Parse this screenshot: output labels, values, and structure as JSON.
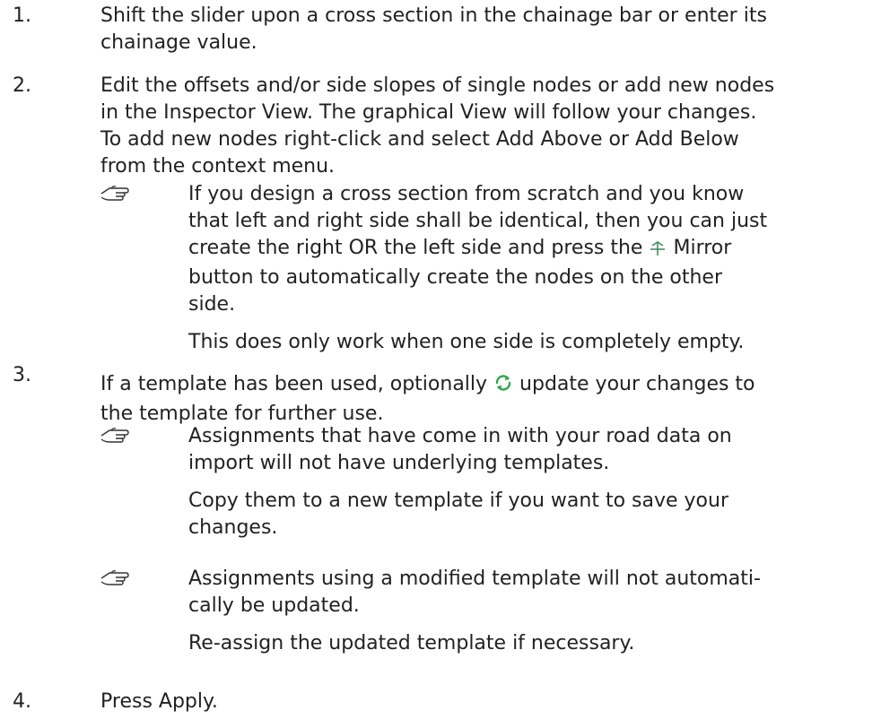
{
  "steps": [
    {
      "number": "1.",
      "lines": [
        "Shift the slider upon a cross section in the chainage bar or enter its",
        "chainage value."
      ]
    },
    {
      "number": "2.",
      "lines": [
        "Edit the offsets and/or side slopes of single nodes or add new nodes",
        "in the Inspector View. The graphical View will follow your changes.",
        "To add new nodes right-click and select Add Above or Add Below",
        "from the context menu."
      ],
      "note": {
        "lines": [
          "If you design a cross section from scratch and you know",
          "that left and right side shall be identical, then you can just"
        ],
        "line3_before": "create the right OR the left side and press the",
        "line3_after": "Mirror",
        "lines_after": [
          "button to automatically create the nodes on the other",
          "side.",
          "This does only work when one side is completely empty."
        ]
      }
    },
    {
      "number": "3.",
      "line1_before": "If a template has been used, optionally",
      "line1_after": "update your changes to",
      "line2": "the template for further use.",
      "notes": [
        {
          "lines": [
            "Assignments that have come in with your road data on",
            "import will not have underlying templates.",
            "Copy them to a new template if you want to save your",
            "changes."
          ]
        },
        {
          "lines": [
            "Assignments using a modified template will not automati-",
            "cally be updated.",
            "Re-assign the updated template if necessary."
          ]
        }
      ]
    },
    {
      "number": "4.",
      "lines": [
        "Press Apply."
      ]
    }
  ],
  "icons": {
    "note": "pointing-hand-icon",
    "mirror": "mirror-icon",
    "update": "update-sync-icon",
    "update_color": "#2fa84f",
    "mirror_color": "#3f8f5a"
  }
}
